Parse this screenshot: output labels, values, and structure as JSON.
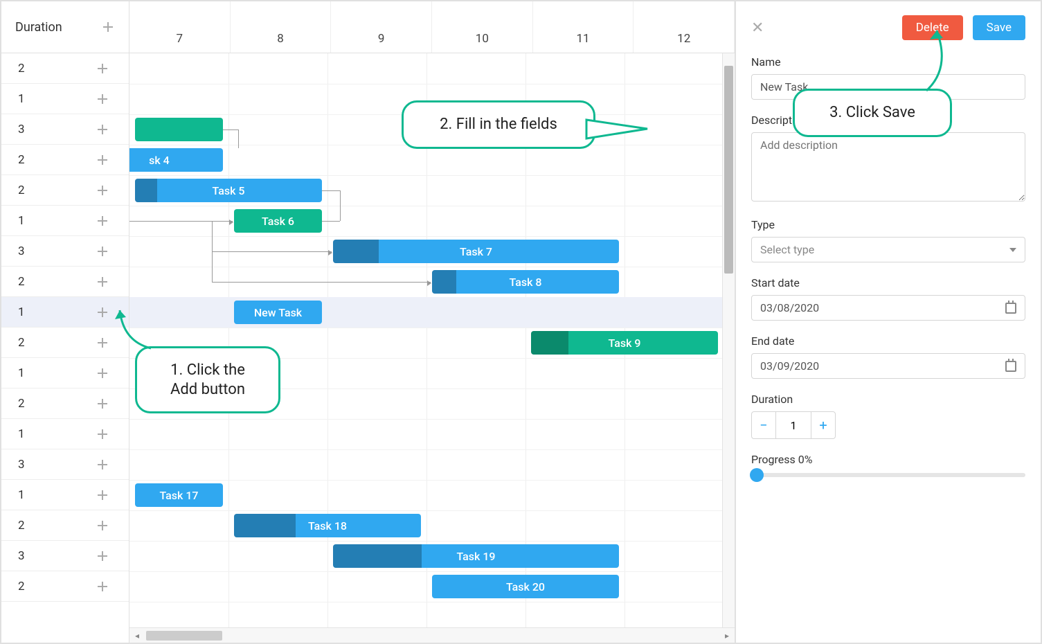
{
  "left": {
    "header": "Duration",
    "rows": [
      {
        "duration": "2"
      },
      {
        "duration": "1"
      },
      {
        "duration": "3"
      },
      {
        "duration": "2"
      },
      {
        "duration": "2"
      },
      {
        "duration": "1"
      },
      {
        "duration": "3"
      },
      {
        "duration": "2"
      },
      {
        "duration": "1",
        "selected": true
      },
      {
        "duration": "2"
      },
      {
        "duration": "1"
      },
      {
        "duration": "2"
      },
      {
        "duration": "1"
      },
      {
        "duration": "3"
      },
      {
        "duration": "1"
      },
      {
        "duration": "2"
      },
      {
        "duration": "3"
      },
      {
        "duration": "2"
      }
    ]
  },
  "timeline": {
    "columns": [
      "7",
      "8",
      "9",
      "10",
      "11",
      "12"
    ],
    "tasks": [
      {
        "row": 2,
        "startCol": 0,
        "spanCols": 1.0,
        "color": "green",
        "label": ""
      },
      {
        "row": 3,
        "startCol": -0.4,
        "spanCols": 1.4,
        "color": "blue",
        "label": "sk 4",
        "progress": 0
      },
      {
        "row": 4,
        "startCol": 0,
        "spanCols": 2.0,
        "color": "blue",
        "label": "Task 5",
        "progress": 0.12
      },
      {
        "row": 5,
        "startCol": 1.0,
        "spanCols": 1.0,
        "color": "green",
        "label": "Task 6",
        "progress": 0
      },
      {
        "row": 6,
        "startCol": 2.0,
        "spanCols": 3.0,
        "color": "blue",
        "label": "Task 7",
        "progress": 0.16
      },
      {
        "row": 7,
        "startCol": 3.0,
        "spanCols": 2.0,
        "color": "blue",
        "label": "Task 8",
        "progress": 0.13
      },
      {
        "row": 8,
        "startCol": 1.0,
        "spanCols": 1.0,
        "color": "blue",
        "label": "New Task",
        "progress": 0
      },
      {
        "row": 9,
        "startCol": 4.0,
        "spanCols": 2.0,
        "color": "green",
        "label": "Task 9",
        "progress": 0.2
      },
      {
        "row": 14,
        "startCol": 0,
        "spanCols": 1.0,
        "color": "blue",
        "label": "Task 17",
        "progress": 0
      },
      {
        "row": 15,
        "startCol": 1.0,
        "spanCols": 2.0,
        "color": "blue",
        "label": "Task 18",
        "progress": 0.33
      },
      {
        "row": 16,
        "startCol": 2.0,
        "spanCols": 3.0,
        "color": "blue",
        "label": "Task 19",
        "progress": 0.31
      },
      {
        "row": 17,
        "startCol": 3.0,
        "spanCols": 2.0,
        "color": "blue",
        "label": "Task 20",
        "progress": 0
      }
    ]
  },
  "callouts": {
    "c1": "1. Click the\nAdd button",
    "c2": "2. Fill in the\nfields",
    "c3": "3. Click Save"
  },
  "form": {
    "delete": "Delete",
    "save": "Save",
    "name_label": "Name",
    "name_value": "New Task",
    "desc_label": "Description",
    "desc_placeholder": "Add description",
    "type_label": "Type",
    "type_placeholder": "Select type",
    "start_label": "Start date",
    "start_value": "03/08/2020",
    "end_label": "End date",
    "end_value": "03/09/2020",
    "duration_label": "Duration",
    "duration_value": "1",
    "progress_label": "Progress 0%"
  }
}
